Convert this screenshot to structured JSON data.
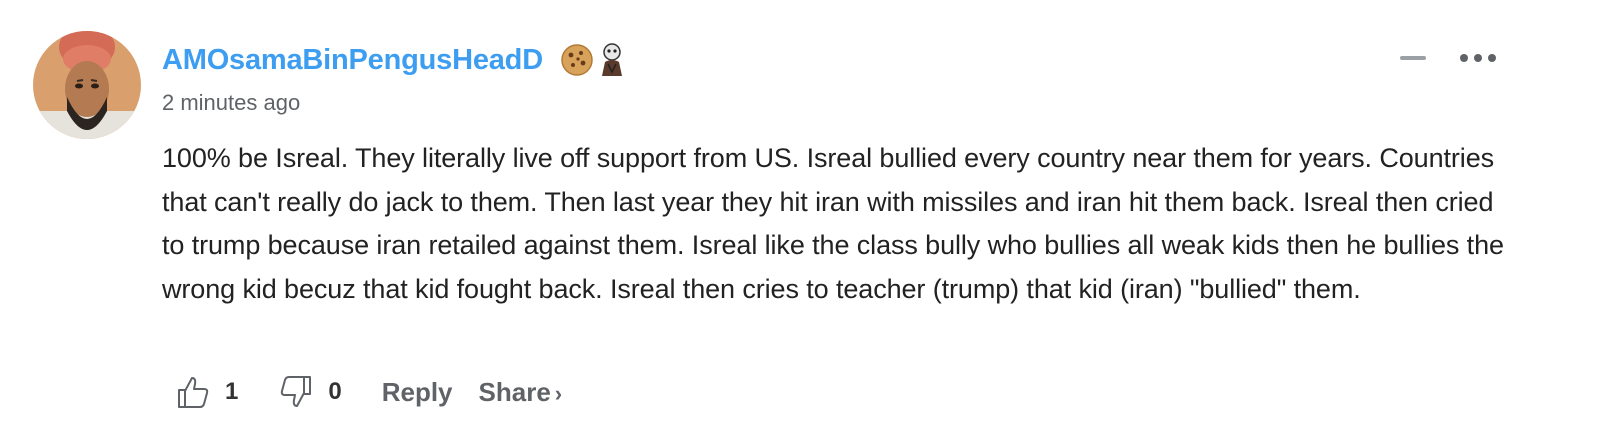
{
  "comment": {
    "author": "AMOsamaBinPengusHeadD",
    "timestamp": "2 minutes ago",
    "text": "100% be Isreal. They literally live off support from US. Isreal bullied every country near them for years. Countries that can't really do jack to them. Then last year they hit iran with missiles and iran hit them back. Isreal then cried to trump because iran retailed against them. Isreal like the class bully who bullies all weak kids then he bullies the wrong kid becuz that kid fought back. Isreal then cries to teacher (trump) that kid (iran) \"bullied\" them.",
    "badges": [
      "cookie-icon",
      "ghost-figure-icon"
    ],
    "upvotes": "1",
    "downvotes": "0"
  },
  "actions": {
    "reply_label": "Reply",
    "share_label": "Share",
    "share_chevron": "›"
  },
  "colors": {
    "username": "#3d9df0",
    "body_text": "#222222",
    "meta": "#5f6368"
  }
}
